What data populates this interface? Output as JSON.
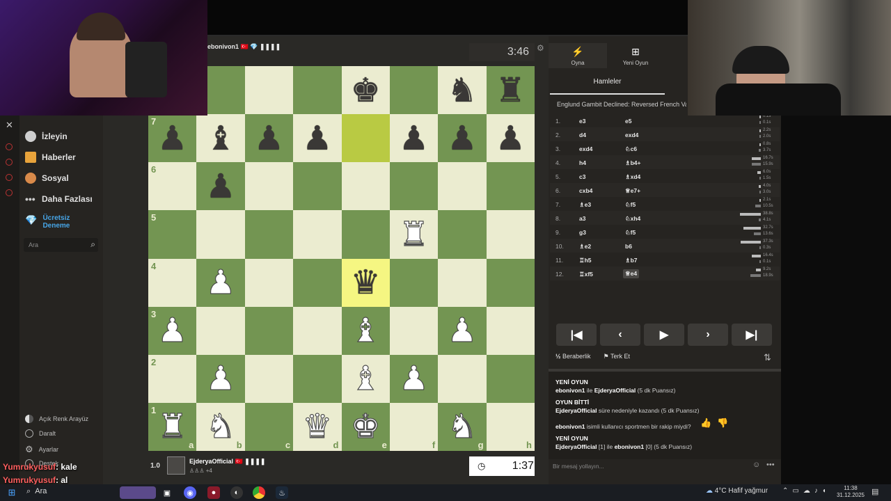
{
  "top_player": {
    "name": "ebonivon1",
    "flag": "🇹🇷",
    "badge": "💎 ❚❚❚❚",
    "clock": "3:46"
  },
  "bottom_player": {
    "rating": "1.0",
    "name": "EjderyaOfficial",
    "flag": "🇹🇷",
    "badge": "❚❚❚❚",
    "captured": "♙♙♙ +4",
    "clock": "1:37"
  },
  "leftnav": {
    "items": [
      {
        "label": "İzleyin",
        "icon": "binoculars-icon"
      },
      {
        "label": "Haberler",
        "icon": "news-icon"
      },
      {
        "label": "Sosyal",
        "icon": "social-icon"
      },
      {
        "label": "Daha Fazlası",
        "icon": "more-icon"
      }
    ],
    "trial": "Ücretsiz Deneme",
    "search_placeholder": "Ara",
    "bottom": [
      {
        "label": "Açık Renk Arayüz",
        "icon": "half-circle-icon"
      },
      {
        "label": "Daralt",
        "icon": "collapse-icon"
      },
      {
        "label": "Ayarlar",
        "icon": "gear-icon"
      },
      {
        "label": "Destek",
        "icon": "help-icon"
      }
    ]
  },
  "board": {
    "ranks": [
      "8",
      "7",
      "6",
      "5",
      "4",
      "3",
      "2",
      "1"
    ],
    "files": [
      "a",
      "b",
      "c",
      "d",
      "e",
      "f",
      "g",
      "h"
    ],
    "rows": [
      [
        "",
        "",
        "",
        "",
        "bk",
        "",
        "bn",
        "br"
      ],
      [
        "bp",
        "bb",
        "bp",
        "bp",
        "",
        "bp",
        "bp",
        "bp"
      ],
      [
        "",
        "bp",
        "",
        "",
        "",
        "",
        "",
        ""
      ],
      [
        "",
        "",
        "",
        "",
        "",
        "wr",
        "",
        ""
      ],
      [
        "",
        "wp",
        "",
        "",
        "bq",
        "",
        "",
        ""
      ],
      [
        "wp",
        "",
        "",
        "",
        "wb",
        "",
        "wp",
        ""
      ],
      [
        "",
        "wp",
        "",
        "",
        "wb",
        "wp",
        "",
        ""
      ],
      [
        "wr",
        "wn",
        "",
        "wq",
        "wk",
        "",
        "wn",
        ""
      ]
    ],
    "highlight": [
      [
        1,
        4
      ],
      [
        4,
        4
      ]
    ]
  },
  "tabs": {
    "play": "Oyna",
    "new_game": "Yeni Oyun",
    "moves": "Hamleler"
  },
  "opening": "Englund Gambit Declined: Reversed French Variat",
  "moves": [
    {
      "n": "1.",
      "w": "e3",
      "b": "e5",
      "tw": "0.1s",
      "tb": "0.1s",
      "bw": 0.02,
      "bb": 0.02
    },
    {
      "n": "2.",
      "w": "d4",
      "b": "exd4",
      "tw": "2.2s",
      "tb": "2.0s",
      "bw": 0.06,
      "bb": 0.05
    },
    {
      "n": "3.",
      "w": "exd4",
      "b": "♘c6",
      "tw": "0.8s",
      "tb": "3.7s",
      "bw": 0.02,
      "bb": 0.1
    },
    {
      "n": "4.",
      "w": "h4",
      "b": "♗b4+",
      "tw": "16.7s",
      "tb": "15.9s",
      "bw": 0.44,
      "bb": 0.42
    },
    {
      "n": "5.",
      "w": "c3",
      "b": "♗xd4",
      "tw": "6.0s",
      "tb": "1.5s",
      "bw": 0.16,
      "bb": 0.04
    },
    {
      "n": "6.",
      "w": "cxb4",
      "b": "♕e7+",
      "tw": "4.0s",
      "tb": "3.0s",
      "bw": 0.1,
      "bb": 0.08
    },
    {
      "n": "7.",
      "w": "♗e3",
      "b": "♘f5",
      "tw": "2.1s",
      "tb": "10.5s",
      "bw": 0.06,
      "bb": 0.28
    },
    {
      "n": "8.",
      "w": "a3",
      "b": "♘xh4",
      "tw": "38.8s",
      "tb": "4.1s",
      "bw": 1.0,
      "bb": 0.11
    },
    {
      "n": "9.",
      "w": "g3",
      "b": "♘f5",
      "tw": "32.7s",
      "tb": "13.6s",
      "bw": 0.84,
      "bb": 0.35
    },
    {
      "n": "10.",
      "w": "♗e2",
      "b": "b6",
      "tw": "37.3s",
      "tb": "0.3s",
      "bw": 0.96,
      "bb": 0.01
    },
    {
      "n": "11.",
      "w": "♖h5",
      "b": "♗b7",
      "tw": "16.4s",
      "tb": "0.1s",
      "bw": 0.42,
      "bb": 0.01
    },
    {
      "n": "12.",
      "w": "♖xf5",
      "b": "♕e4",
      "tw": "9.2s",
      "tb": "18.9s",
      "bw": 0.24,
      "bb": 0.49
    }
  ],
  "controls": {
    "first": "|◀",
    "prev": "‹",
    "play": "▶",
    "next": "›",
    "last": "▶|"
  },
  "actions": {
    "draw_icon": "½",
    "draw": "Beraberlik",
    "resign": "Terk Et"
  },
  "chat": {
    "lines": [
      {
        "bold": "YENİ OYUN",
        "text": ""
      },
      {
        "bold": "ebonivon1",
        "text": " ile ",
        "bold2": "EjderyaOfficial",
        "text2": " (5 dk Puansız)"
      },
      {
        "bold": "OYUN BİTTİ",
        "text": ""
      },
      {
        "bold": "EjderyaOfficial",
        "text": " süre nedeniyle kazandı (5 dk Puansız)"
      },
      {
        "bold": "ebonivon1",
        "text": " isimli kullanıcı sportmen bir rakip miydi?"
      },
      {
        "bold": "YENİ OYUN",
        "text": ""
      },
      {
        "bold": "EjderyaOfficial",
        "text": " [1] ile ",
        "bold2": "ebonivon1",
        "text2": " [0] (5 dk Puansız)"
      }
    ],
    "input_placeholder": "Bir mesaj yollayın..."
  },
  "overlay_chat": [
    {
      "user": "Yumrukyusuf",
      "msg": ": kale"
    },
    {
      "user": "Yumrukyusuf",
      "msg": ": al"
    }
  ],
  "taskbar": {
    "search": "Ara",
    "weather": "4°C  Hafif yağmur",
    "time": "11:38",
    "date": "31.12.2025"
  }
}
